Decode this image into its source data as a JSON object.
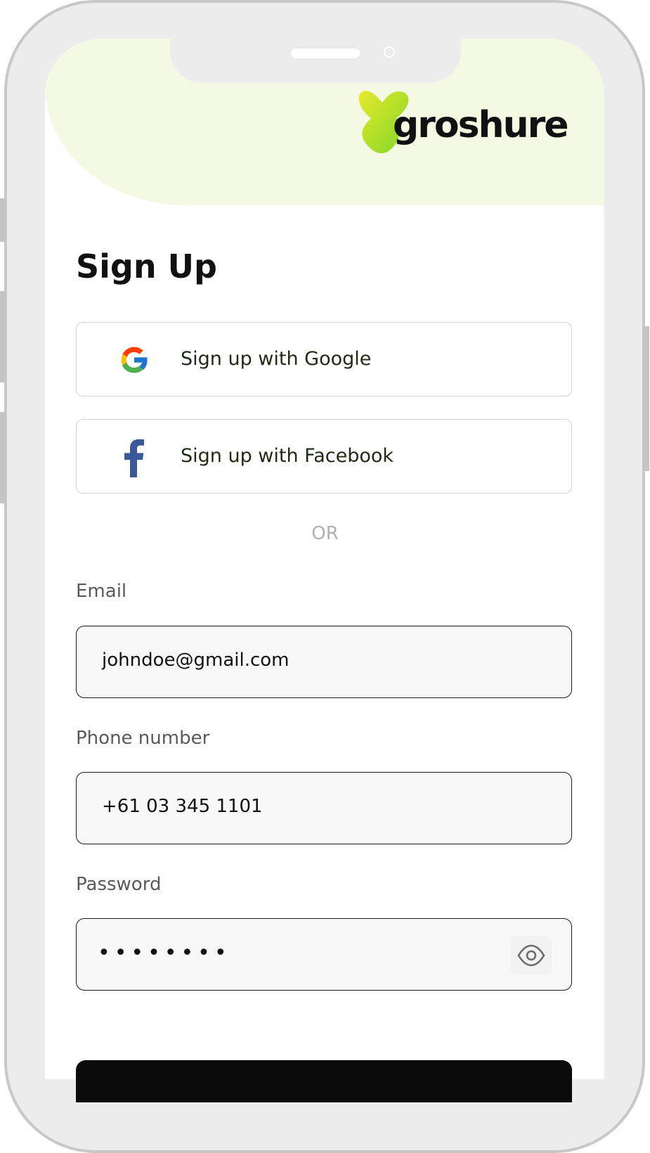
{
  "brand": {
    "name": "groshure"
  },
  "page": {
    "title": "Sign Up"
  },
  "social": {
    "google_label": "Sign up with Google",
    "facebook_label": "Sign up with Facebook"
  },
  "divider": {
    "text": "OR"
  },
  "form": {
    "email": {
      "label": "Email",
      "value": "johndoe@gmail.com"
    },
    "phone": {
      "label": "Phone number",
      "value": "+61 03 345 1101"
    },
    "password": {
      "label": "Password",
      "masked_value": "••••••••"
    }
  },
  "colors": {
    "header_bg": "#f4f9e4",
    "logo_green": "#b6e21f",
    "facebook_blue": "#3b5998",
    "submit_button": "#0b0b0b"
  },
  "icons": {
    "google": "google-icon",
    "facebook": "facebook-icon",
    "show_password": "eye-icon"
  }
}
